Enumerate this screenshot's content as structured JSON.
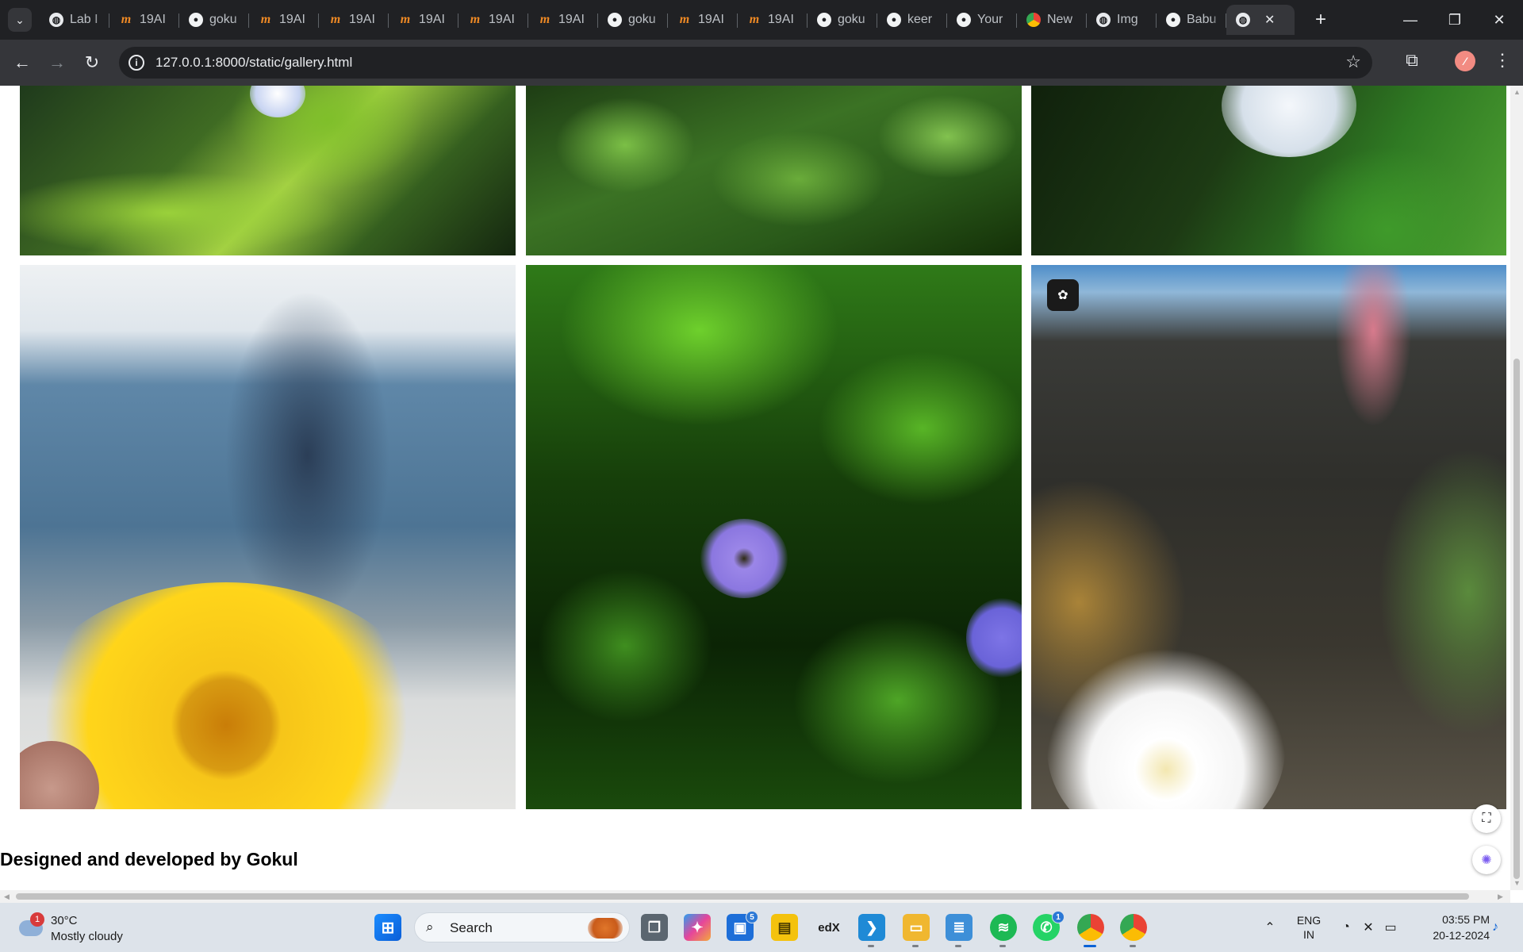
{
  "browser": {
    "tabs": [
      {
        "title": "Lab I",
        "icon": "globe-icon"
      },
      {
        "title": "19AI",
        "icon": "coursera-icon"
      },
      {
        "title": "goku",
        "icon": "github-icon"
      },
      {
        "title": "19AI",
        "icon": "coursera-icon"
      },
      {
        "title": "19AI",
        "icon": "coursera-icon"
      },
      {
        "title": "19AI",
        "icon": "coursera-icon"
      },
      {
        "title": "19AI",
        "icon": "coursera-icon"
      },
      {
        "title": "19AI",
        "icon": "coursera-icon"
      },
      {
        "title": "goku",
        "icon": "github-icon"
      },
      {
        "title": "19AI",
        "icon": "coursera-icon"
      },
      {
        "title": "19AI",
        "icon": "coursera-icon"
      },
      {
        "title": "goku",
        "icon": "github-icon"
      },
      {
        "title": "keer",
        "icon": "github-icon"
      },
      {
        "title": "Your",
        "icon": "github-icon"
      },
      {
        "title": "New",
        "icon": "chrome-icon"
      },
      {
        "title": "Img",
        "icon": "globe-icon"
      },
      {
        "title": "Babu",
        "icon": "github-icon"
      }
    ],
    "active_tab_icon": "globe-icon",
    "address_bar": {
      "url": "127.0.0.1:8000/static/gallery.html"
    }
  },
  "page": {
    "gallery": [
      {
        "subject": "green leaves with pale bloom"
      },
      {
        "subject": "leafy green plant"
      },
      {
        "subject": "white flower over green leaf"
      },
      {
        "subject": "yellow daisy held in hand"
      },
      {
        "subject": "violet flower among green leaves"
      },
      {
        "subject": "white star flower on blurred background"
      }
    ],
    "footer": {
      "credit": "Designed and developed by Gokul"
    }
  },
  "taskbar": {
    "weather": {
      "temperature": "30°C",
      "condition": "Mostly cloudy",
      "badge": "1"
    },
    "search_placeholder": "Search",
    "pinned_apps": [
      {
        "name": "task-view",
        "badge": ""
      },
      {
        "name": "copilot",
        "badge": ""
      },
      {
        "name": "microsoft-store",
        "badge": "5"
      },
      {
        "name": "sticky-notes",
        "badge": ""
      },
      {
        "name": "edx",
        "label": "edX",
        "badge": ""
      },
      {
        "name": "vscode",
        "badge": ""
      },
      {
        "name": "file-explorer",
        "badge": ""
      },
      {
        "name": "notepad",
        "badge": ""
      },
      {
        "name": "spotify",
        "badge": ""
      },
      {
        "name": "whatsapp",
        "badge": "1"
      },
      {
        "name": "chrome",
        "badge": ""
      },
      {
        "name": "chrome",
        "badge": ""
      }
    ],
    "language": {
      "line1": "ENG",
      "line2": "IN"
    },
    "clock": {
      "time": "03:55 PM",
      "date": "20-12-2024"
    }
  },
  "colors": {
    "browser_frame": "#202124",
    "toolbar": "#35363a",
    "page_background": "#ffffff",
    "taskbar": "#dde3ea"
  }
}
